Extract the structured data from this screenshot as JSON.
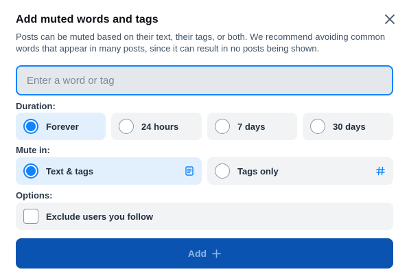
{
  "dialog": {
    "title": "Add muted words and tags",
    "description": "Posts can be muted based on their text, their tags, or both. We recommend avoiding common words that appear in many posts, since it can result in no posts being shown.",
    "close_icon": "close-icon"
  },
  "input": {
    "placeholder": "Enter a word or tag",
    "value": ""
  },
  "duration": {
    "label": "Duration:",
    "options": [
      {
        "label": "Forever",
        "selected": true
      },
      {
        "label": "24 hours",
        "selected": false
      },
      {
        "label": "7 days",
        "selected": false
      },
      {
        "label": "30 days",
        "selected": false
      }
    ]
  },
  "mute_in": {
    "label": "Mute in:",
    "options": [
      {
        "label": "Text & tags",
        "selected": true,
        "icon": "document-icon"
      },
      {
        "label": "Tags only",
        "selected": false,
        "icon": "hashtag-icon"
      }
    ]
  },
  "options": {
    "label": "Options:",
    "exclude_following": {
      "label": "Exclude users you follow",
      "checked": false
    }
  },
  "add_button": {
    "label": "Add",
    "icon": "plus-icon"
  },
  "colors": {
    "accent": "#1083fe",
    "primary_button": "#0a53b1",
    "selected_bg": "#e2f0fe",
    "option_bg": "#f1f3f5"
  }
}
